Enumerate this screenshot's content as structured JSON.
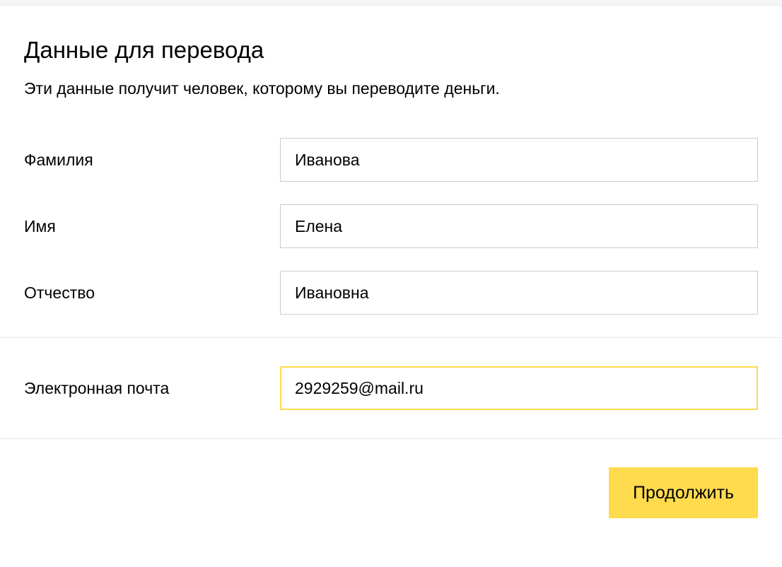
{
  "header": {
    "title": "Данные для перевода",
    "subtitle": "Эти данные получит человек, которому вы переводите деньги."
  },
  "form": {
    "surname": {
      "label": "Фамилия",
      "value": "Иванова"
    },
    "name": {
      "label": "Имя",
      "value": "Елена"
    },
    "patronymic": {
      "label": "Отчество",
      "value": "Ивановна"
    },
    "email": {
      "label": "Электронная почта",
      "value": "2929259@mail.ru"
    }
  },
  "actions": {
    "continue_label": "Продолжить"
  }
}
